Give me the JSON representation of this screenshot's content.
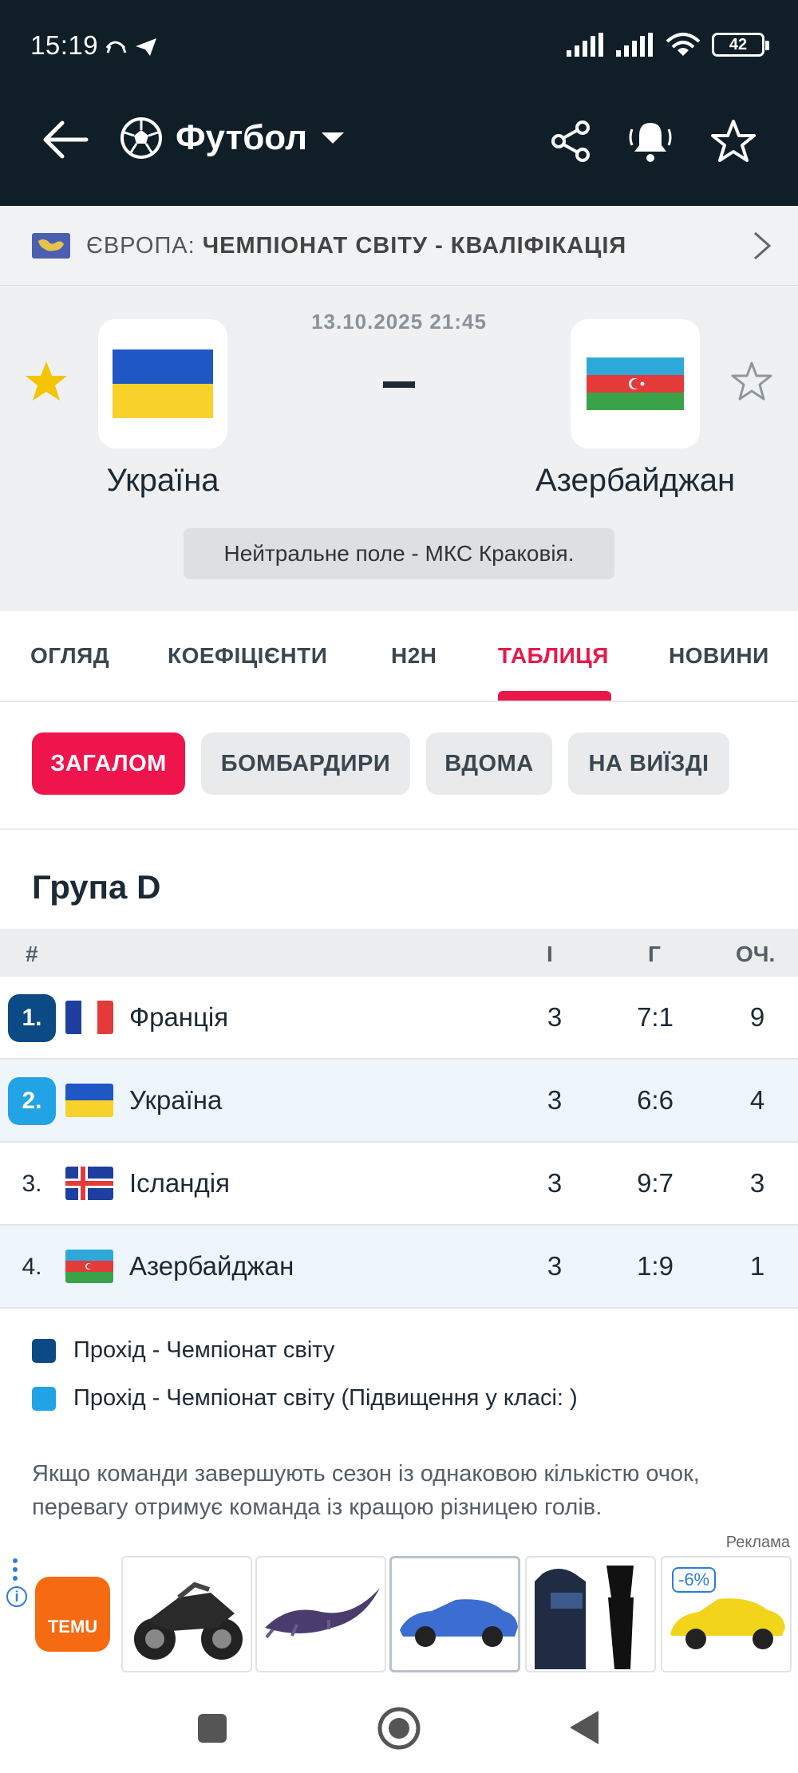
{
  "status_bar": {
    "time": "15:19",
    "battery": "42"
  },
  "nav": {
    "sport": "Футбол"
  },
  "competition": {
    "region": "ЄВРОПА:",
    "name": "ЧЕМПІОНАТ СВІТУ - КВАЛІФІКАЦІЯ"
  },
  "match": {
    "datetime": "13.10.2025 21:45",
    "home": {
      "name": "Україна",
      "favorite": true
    },
    "away": {
      "name": "Азербайджан",
      "favorite": false
    },
    "score": "-",
    "venue": "Нейтральне поле - МКС Краковія."
  },
  "tabs": [
    {
      "label": "ОГЛЯД"
    },
    {
      "label": "КОЕФІЦІЄНТИ"
    },
    {
      "label": "H2H"
    },
    {
      "label": "ТАБЛИЦЯ",
      "active": true
    },
    {
      "label": "НОВИНИ"
    }
  ],
  "chips": [
    {
      "label": "ЗАГАЛОМ",
      "active": true
    },
    {
      "label": "БОМБАРДИРИ"
    },
    {
      "label": "ВДОМА"
    },
    {
      "label": "НА ВИЇЗДІ"
    }
  ],
  "standings": {
    "group": "Група D",
    "columns": {
      "rank": "#",
      "played": "І",
      "goals": "Г",
      "points": "ОЧ."
    },
    "rows": [
      {
        "rank": "1.",
        "team": "Франція",
        "played": "3",
        "goals": "7:1",
        "points": "9",
        "flag": "france-flag",
        "rank_color": "#0b4a85"
      },
      {
        "rank": "2.",
        "team": "Україна",
        "played": "3",
        "goals": "6:6",
        "points": "4",
        "flag": "ukraine-flag",
        "rank_color": "#22a3e6"
      },
      {
        "rank": "3.",
        "team": "Ісландія",
        "played": "3",
        "goals": "9:7",
        "points": "3",
        "flag": "iceland-flag"
      },
      {
        "rank": "4.",
        "team": "Азербайджан",
        "played": "3",
        "goals": "1:9",
        "points": "1",
        "flag": "azerbaijan-flag"
      }
    ]
  },
  "legend": [
    {
      "label": "Прохід - Чемпіонат світу",
      "color": "#0b4a85"
    },
    {
      "label": "Прохід - Чемпіонат світу (Підвищення у класі: )",
      "color": "#22a3e6"
    }
  ],
  "note": "Якщо команди завершують сезон із однаковою кількістю очок, перевагу отримує команда із кращою різницею голів.",
  "ad": {
    "label": "Реклама",
    "brand": "TEMU",
    "items": [
      "motorcycle-model",
      "toy-lizard",
      "blue-convertible-model",
      "ski-suit",
      "yellow-car-model"
    ],
    "discount_badge": "-6%"
  },
  "colors": {
    "accent": "#e8184a",
    "topbar": "#0f1e27"
  }
}
